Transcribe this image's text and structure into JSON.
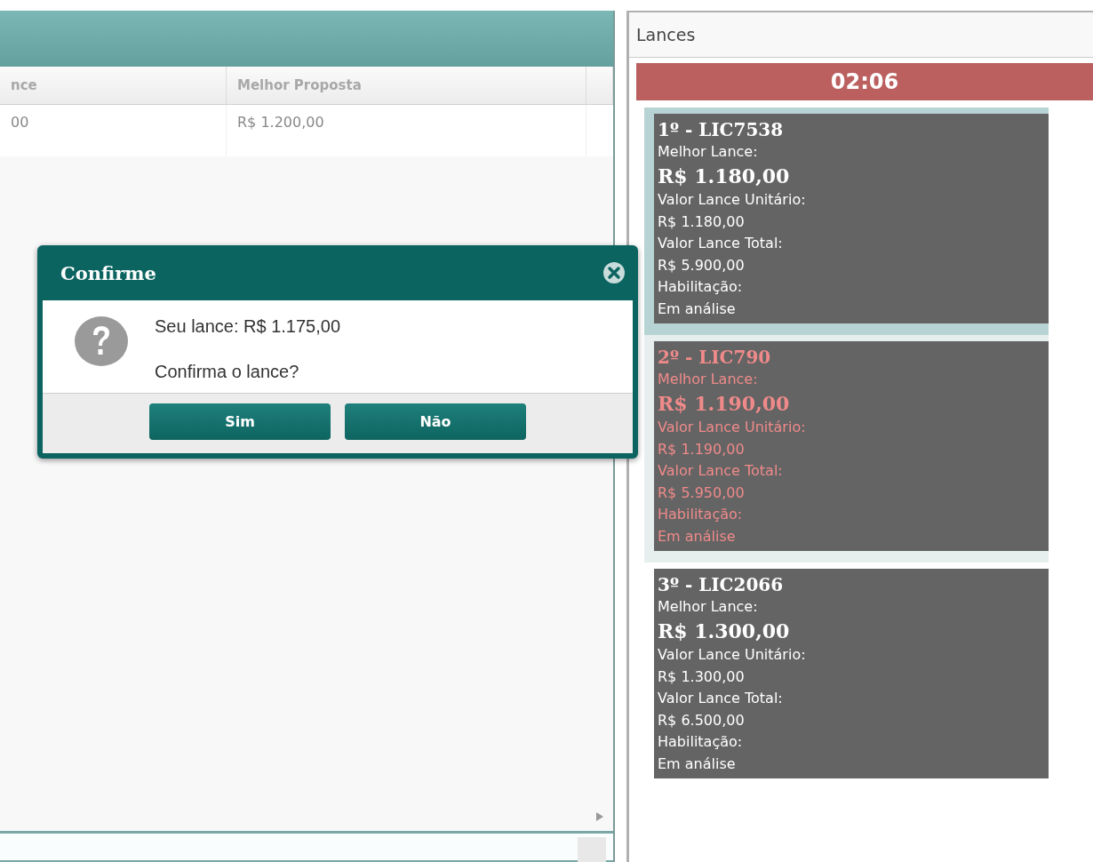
{
  "grid": {
    "columns": [
      {
        "label": "nce"
      },
      {
        "label": "Melhor Proposta"
      }
    ],
    "rows": [
      {
        "cells": [
          "00",
          "R$ 1.200,00"
        ]
      }
    ]
  },
  "bids_panel": {
    "title": "Lances",
    "timer": "02:06",
    "bids": [
      {
        "kind": "leader",
        "title": "1º - LIC7538",
        "best_label": "Melhor Lance:",
        "best_value": "R$ 1.180,00",
        "unit_label": "Valor Lance Unitário:",
        "unit_value": "R$ 1.180,00",
        "total_label": "Valor Lance Total:",
        "total_value": "R$ 5.900,00",
        "status_label": "Habilitação:",
        "status_value": "Em análise"
      },
      {
        "kind": "mine",
        "title": "2º - LIC790",
        "best_label": "Melhor Lance:",
        "best_value": "R$ 1.190,00",
        "unit_label": "Valor Lance Unitário:",
        "unit_value": "R$ 1.190,00",
        "total_label": "Valor Lance Total:",
        "total_value": "R$ 5.950,00",
        "status_label": "Habilitação:",
        "status_value": "Em análise"
      },
      {
        "kind": "other",
        "title": "3º - LIC2066",
        "best_label": "Melhor Lance:",
        "best_value": "R$ 1.300,00",
        "unit_label": "Valor Lance Unitário:",
        "unit_value": "R$ 1.300,00",
        "total_label": "Valor Lance Total:",
        "total_value": "R$ 6.500,00",
        "status_label": "Habilitação:",
        "status_value": "Em análise"
      }
    ]
  },
  "dialog": {
    "title": "Confirme",
    "lines": [
      "Seu lance: R$ 1.175,00",
      "Confirma o lance?"
    ],
    "buttons": [
      "Sim",
      "Não"
    ]
  }
}
